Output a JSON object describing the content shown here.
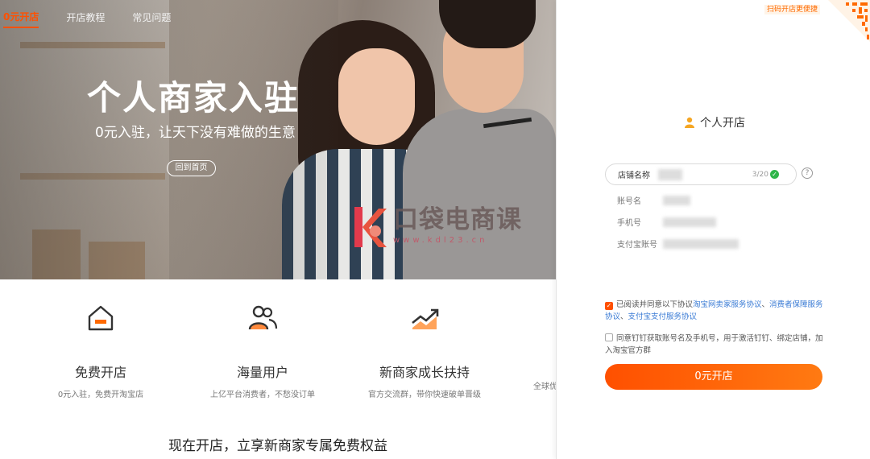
{
  "nav": {
    "items": [
      {
        "label": "0元开店"
      },
      {
        "label": "开店教程"
      },
      {
        "label": "常见问题"
      }
    ]
  },
  "hero": {
    "title": "个人商家入驻",
    "subtitle": "0元入驻，让天下没有难做的生意",
    "back_button": "回到首页"
  },
  "watermark": {
    "brand": "口袋电商课",
    "url": "www.kdl23.cn"
  },
  "features": [
    {
      "icon": "shop-icon",
      "title": "免费开店",
      "desc": "0元入驻，免费开淘宝店"
    },
    {
      "icon": "users-icon",
      "title": "海量用户",
      "desc": "上亿平台消费者，不愁没订单"
    },
    {
      "icon": "growth-chart-icon",
      "title": "新商家成长扶持",
      "desc": "官方交流群，带你快速破单晋级"
    }
  ],
  "feature_partial_desc": "全球优",
  "bottom_heading": "现在开店，立享新商家专属免费权益",
  "panel": {
    "qr_label": "扫码开店更便捷",
    "title": "个人开店",
    "store_name_label": "店铺名称",
    "store_name_count": "3/20",
    "help_glyph": "?",
    "account_label": "账号名",
    "phone_label": "手机号",
    "alipay_label": "支付宝账号",
    "agreement": {
      "prefix": "已阅读并同意以下协议",
      "link1": "淘宝网卖家服务协议",
      "sep1": "、",
      "link2": "消费者保障服务协议",
      "sep2": "、",
      "link3": "支付宝支付服务协议"
    },
    "dingtalk_consent": "同意钉钉获取账号名及手机号，用于激活钉钉、绑定店铺，加入淘宝官方群",
    "submit": "0元开店"
  },
  "colors": {
    "accent": "#ff5000",
    "link": "#3a7bd5",
    "success": "#2fb54a"
  }
}
